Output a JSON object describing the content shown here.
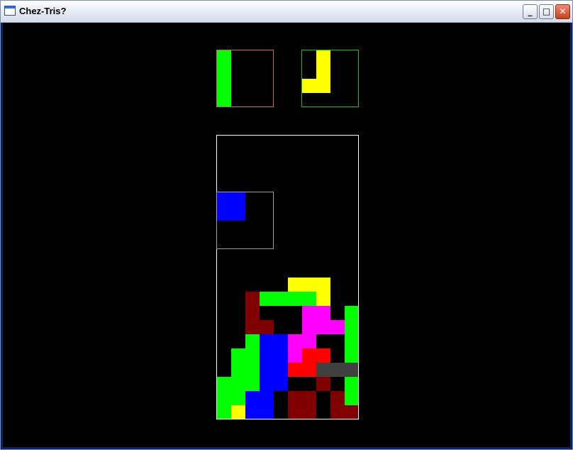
{
  "window": {
    "title": "Chez-Tris?",
    "buttons": {
      "minimize": "_",
      "maximize": "□",
      "close": "✕"
    }
  },
  "colors": {
    "G": "#00ff00",
    "Y": "#ffff00",
    "B": "#0000ff",
    "M": "#ff00ff",
    "D": "#800000",
    "R": "#ff0000",
    "K": "#404040",
    "hold_border": "#c86464",
    "next_border": "#00c800",
    "board_border": "#ffffff",
    "current_border": "#a0a0a0"
  },
  "hold_piece": {
    "grid": [
      "G...",
      "G...",
      "G...",
      "G..."
    ]
  },
  "next_piece": {
    "grid": [
      ".Y..",
      ".Y..",
      "YY..",
      "...."
    ]
  },
  "current_piece": {
    "grid": [
      "BB..",
      "BB..",
      "....",
      "...."
    ]
  },
  "board": {
    "grid": [
      "..........",
      "..........",
      "..........",
      "..........",
      "..........",
      "..........",
      "..........",
      "..........",
      "..........",
      "..........",
      ".....YYY..",
      "..DGGGGY..",
      "..D...MM.G",
      "..DD..MMMG",
      "..GBBMM..G",
      ".GGBBMRR.G",
      ".GGBBRRKKK",
      "GGGBB..D.G",
      "GGBB.DD.DG",
      "GYBB.DD.DDDG"
    ]
  }
}
